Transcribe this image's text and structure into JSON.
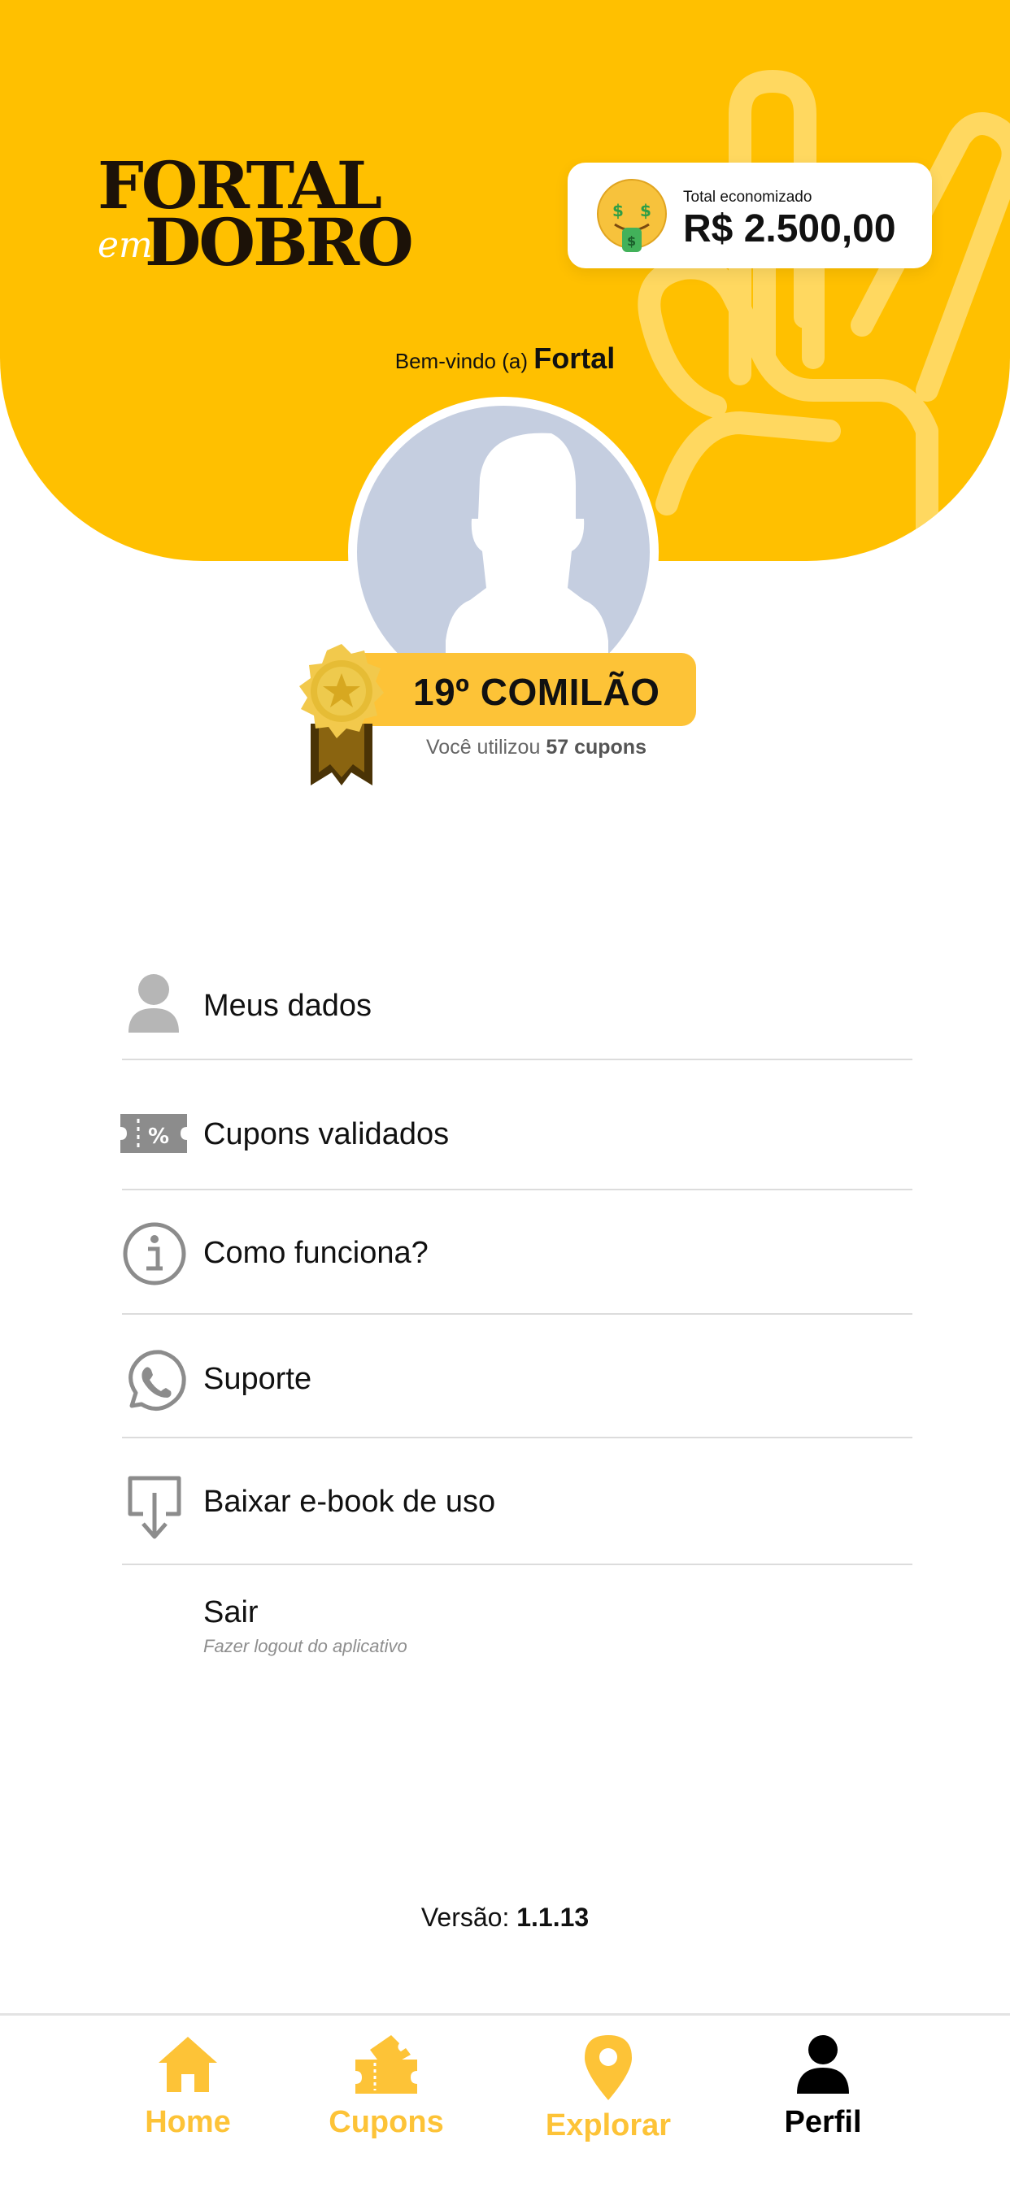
{
  "brand": {
    "logo_line1": "FORTAL",
    "logo_em": "em",
    "logo_line2": "DOBRO",
    "primary_color": "#FFC000",
    "accent_color": "#FDC337"
  },
  "savings": {
    "label": "Total economizado",
    "value": "R$ 2.500,00",
    "icon": "money-mouth-face-icon"
  },
  "welcome": {
    "prefix": "Bem-vindo (a)",
    "name": "Fortal"
  },
  "profile": {
    "avatar_icon": "user-silhouette-icon",
    "rank_label": "19º COMILÃO",
    "coupons_prefix": "Você utilizou",
    "coupons_count": "57 cupons"
  },
  "menu": {
    "items": [
      {
        "label": "Meus dados",
        "icon": "user-icon"
      },
      {
        "label": "Cupons validados",
        "icon": "ticket-percent-icon"
      },
      {
        "label": "Como funciona?",
        "icon": "info-icon"
      },
      {
        "label": "Suporte",
        "icon": "whatsapp-icon"
      },
      {
        "label": "Baixar e-book de uso",
        "icon": "download-icon"
      }
    ],
    "logout": {
      "label": "Sair",
      "sublabel": "Fazer logout do aplicativo"
    }
  },
  "version": {
    "prefix": "Versão:",
    "number": "1.1.13"
  },
  "tabbar": {
    "tabs": [
      {
        "label": "Home",
        "icon": "home-icon",
        "active": false
      },
      {
        "label": "Cupons",
        "icon": "ticket-icon",
        "active": false
      },
      {
        "label": "Explorar",
        "icon": "map-pin-icon",
        "active": false
      },
      {
        "label": "Perfil",
        "icon": "user-icon",
        "active": true
      }
    ],
    "active_color": "#000000",
    "inactive_color": "#FDC337"
  }
}
